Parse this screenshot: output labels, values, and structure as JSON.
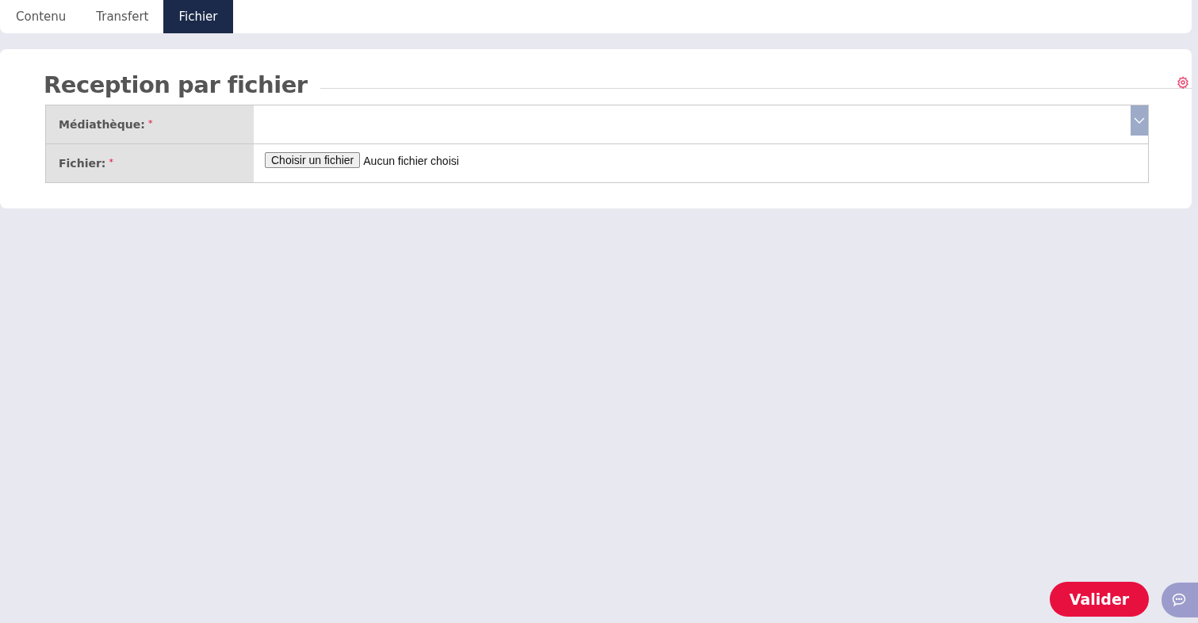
{
  "tabs": [
    {
      "label": "Contenu",
      "selected": false
    },
    {
      "label": "Transfert",
      "selected": false
    },
    {
      "label": "Fichier",
      "selected": true
    }
  ],
  "form": {
    "title": "Reception par fichier",
    "rows": [
      {
        "kind": "select",
        "label": "Médiathèque:",
        "required_mark": "*"
      },
      {
        "kind": "file",
        "label": "Fichier:",
        "required_mark": "*",
        "button": "Choisir un fichier",
        "status": "Aucun fichier choisi"
      }
    ]
  },
  "submit_button": "Valider"
}
